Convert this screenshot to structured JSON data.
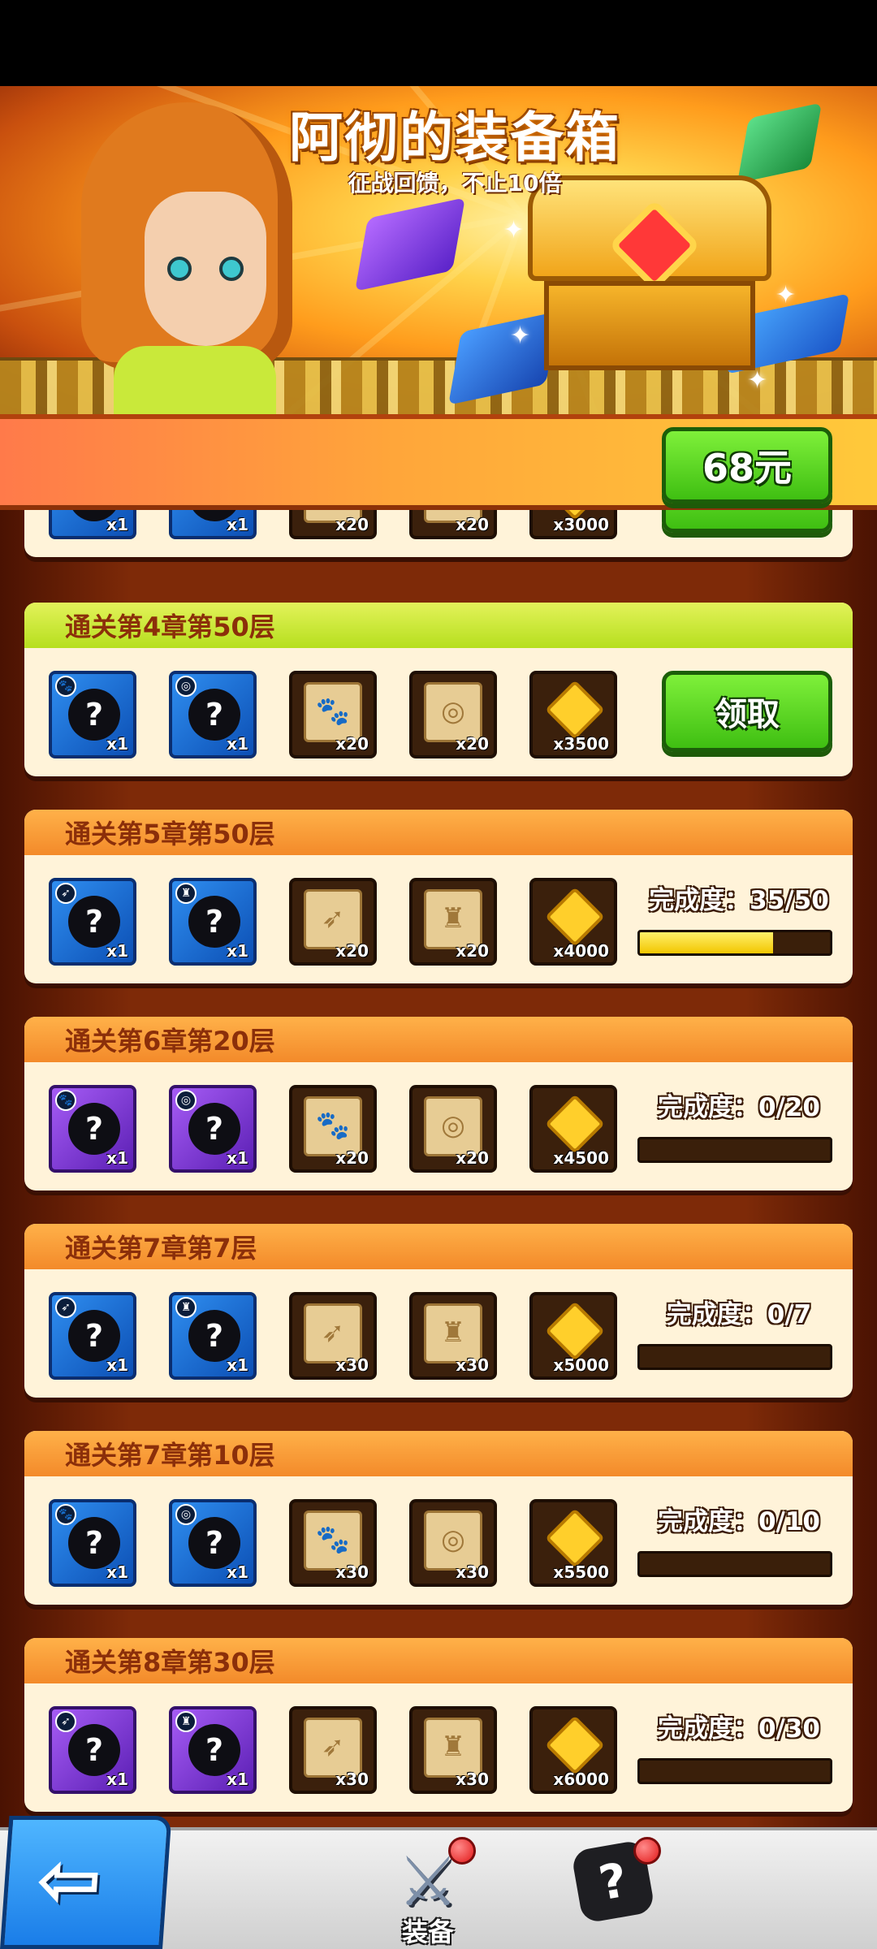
{
  "banner": {
    "title": "阿彻的装备箱",
    "subtitle": "征战回馈，不止10倍"
  },
  "price_button": "68元",
  "colors": {
    "claim_green": "#4fcf1c",
    "header_orange": "#f59a34",
    "header_green": "#c6e634",
    "card_bg": "#fff3d9",
    "item_blue": "#1f6fd4",
    "item_purple": "#7a3bd6",
    "progress_yellow": "#f7d61a"
  },
  "partial_card": {
    "items": [
      {
        "type": "equipment",
        "rarity": "blue",
        "icon": "paw-icon",
        "qty": "x1"
      },
      {
        "type": "equipment",
        "rarity": "blue",
        "icon": "ring-icon",
        "qty": "x1"
      },
      {
        "type": "scroll",
        "icon": "paw-scroll-icon",
        "qty": "x20"
      },
      {
        "type": "scroll",
        "icon": "ring-scroll-icon",
        "qty": "x20"
      },
      {
        "type": "gem",
        "icon": "gold-gem-icon",
        "qty": "x3000"
      }
    ]
  },
  "rewards": [
    {
      "title": "通关第4章第50层",
      "state": "claimable",
      "claim_label": "领取",
      "items": [
        {
          "type": "equipment",
          "rarity": "blue",
          "icon": "paw-icon",
          "glyph": "?",
          "badge": "🐾",
          "qty": "x1"
        },
        {
          "type": "equipment",
          "rarity": "blue",
          "icon": "ring-icon",
          "glyph": "?",
          "badge": "◎",
          "qty": "x1"
        },
        {
          "type": "scroll",
          "icon": "paw-scroll-icon",
          "symbol": "🐾",
          "qty": "x20"
        },
        {
          "type": "scroll",
          "icon": "ring-scroll-icon",
          "symbol": "◎",
          "qty": "x20"
        },
        {
          "type": "gem",
          "icon": "gold-gem-icon",
          "qty": "x3500"
        }
      ]
    },
    {
      "title": "通关第5章第50层",
      "state": "progress",
      "progress_label": "完成度：35/50",
      "progress": 0.7,
      "items": [
        {
          "type": "equipment",
          "rarity": "blue",
          "icon": "bow-icon",
          "glyph": "?",
          "badge": "➶",
          "qty": "x1"
        },
        {
          "type": "equipment",
          "rarity": "blue",
          "icon": "armor-icon",
          "glyph": "?",
          "badge": "♜",
          "qty": "x1"
        },
        {
          "type": "scroll",
          "icon": "bow-scroll-icon",
          "symbol": "➶",
          "qty": "x20"
        },
        {
          "type": "scroll",
          "icon": "armor-scroll-icon",
          "symbol": "♜",
          "qty": "x20"
        },
        {
          "type": "gem",
          "icon": "gold-gem-icon",
          "qty": "x4000"
        }
      ]
    },
    {
      "title": "通关第6章第20层",
      "state": "progress",
      "progress_label": "完成度：0/20",
      "progress": 0,
      "items": [
        {
          "type": "equipment",
          "rarity": "purple",
          "icon": "paw-icon",
          "glyph": "?",
          "badge": "🐾",
          "qty": "x1"
        },
        {
          "type": "equipment",
          "rarity": "purple",
          "icon": "ring-icon",
          "glyph": "?",
          "badge": "◎",
          "qty": "x1"
        },
        {
          "type": "scroll",
          "icon": "paw-scroll-icon",
          "symbol": "🐾",
          "qty": "x20"
        },
        {
          "type": "scroll",
          "icon": "ring-scroll-icon",
          "symbol": "◎",
          "qty": "x20"
        },
        {
          "type": "gem",
          "icon": "gold-gem-icon",
          "qty": "x4500"
        }
      ]
    },
    {
      "title": "通关第7章第7层",
      "state": "progress",
      "progress_label": "完成度：0/7",
      "progress": 0,
      "items": [
        {
          "type": "equipment",
          "rarity": "blue",
          "icon": "bow-icon",
          "glyph": "?",
          "badge": "➶",
          "qty": "x1"
        },
        {
          "type": "equipment",
          "rarity": "blue",
          "icon": "armor-icon",
          "glyph": "?",
          "badge": "♜",
          "qty": "x1"
        },
        {
          "type": "scroll",
          "icon": "bow-scroll-icon",
          "symbol": "➶",
          "qty": "x30"
        },
        {
          "type": "scroll",
          "icon": "armor-scroll-icon",
          "symbol": "♜",
          "qty": "x30"
        },
        {
          "type": "gem",
          "icon": "gold-gem-icon",
          "qty": "x5000"
        }
      ]
    },
    {
      "title": "通关第7章第10层",
      "state": "progress",
      "progress_label": "完成度：0/10",
      "progress": 0,
      "items": [
        {
          "type": "equipment",
          "rarity": "blue",
          "icon": "paw-icon",
          "glyph": "?",
          "badge": "🐾",
          "qty": "x1"
        },
        {
          "type": "equipment",
          "rarity": "blue",
          "icon": "ring-icon",
          "glyph": "?",
          "badge": "◎",
          "qty": "x1"
        },
        {
          "type": "scroll",
          "icon": "paw-scroll-icon",
          "symbol": "🐾",
          "qty": "x30"
        },
        {
          "type": "scroll",
          "icon": "ring-scroll-icon",
          "symbol": "◎",
          "qty": "x30"
        },
        {
          "type": "gem",
          "icon": "gold-gem-icon",
          "qty": "x5500"
        }
      ]
    },
    {
      "title": "通关第8章第30层",
      "state": "progress",
      "progress_label": "完成度：0/30",
      "progress": 0,
      "items": [
        {
          "type": "equipment",
          "rarity": "purple",
          "icon": "bow-icon",
          "glyph": "?",
          "badge": "➶",
          "qty": "x1"
        },
        {
          "type": "equipment",
          "rarity": "purple",
          "icon": "armor-icon",
          "glyph": "?",
          "badge": "♜",
          "qty": "x1"
        },
        {
          "type": "scroll",
          "icon": "bow-scroll-icon",
          "symbol": "➶",
          "qty": "x30"
        },
        {
          "type": "scroll",
          "icon": "armor-scroll-icon",
          "symbol": "♜",
          "qty": "x30"
        },
        {
          "type": "gem",
          "icon": "gold-gem-icon",
          "qty": "x6000"
        }
      ]
    }
  ],
  "nav": {
    "back_icon": "back-arrow-icon",
    "tabs": [
      {
        "label": "装备",
        "icon": "crossed-swords-icon",
        "has_notification": true
      },
      {
        "label": "",
        "icon": "mystery-puzzle-icon",
        "has_notification": true
      }
    ]
  }
}
